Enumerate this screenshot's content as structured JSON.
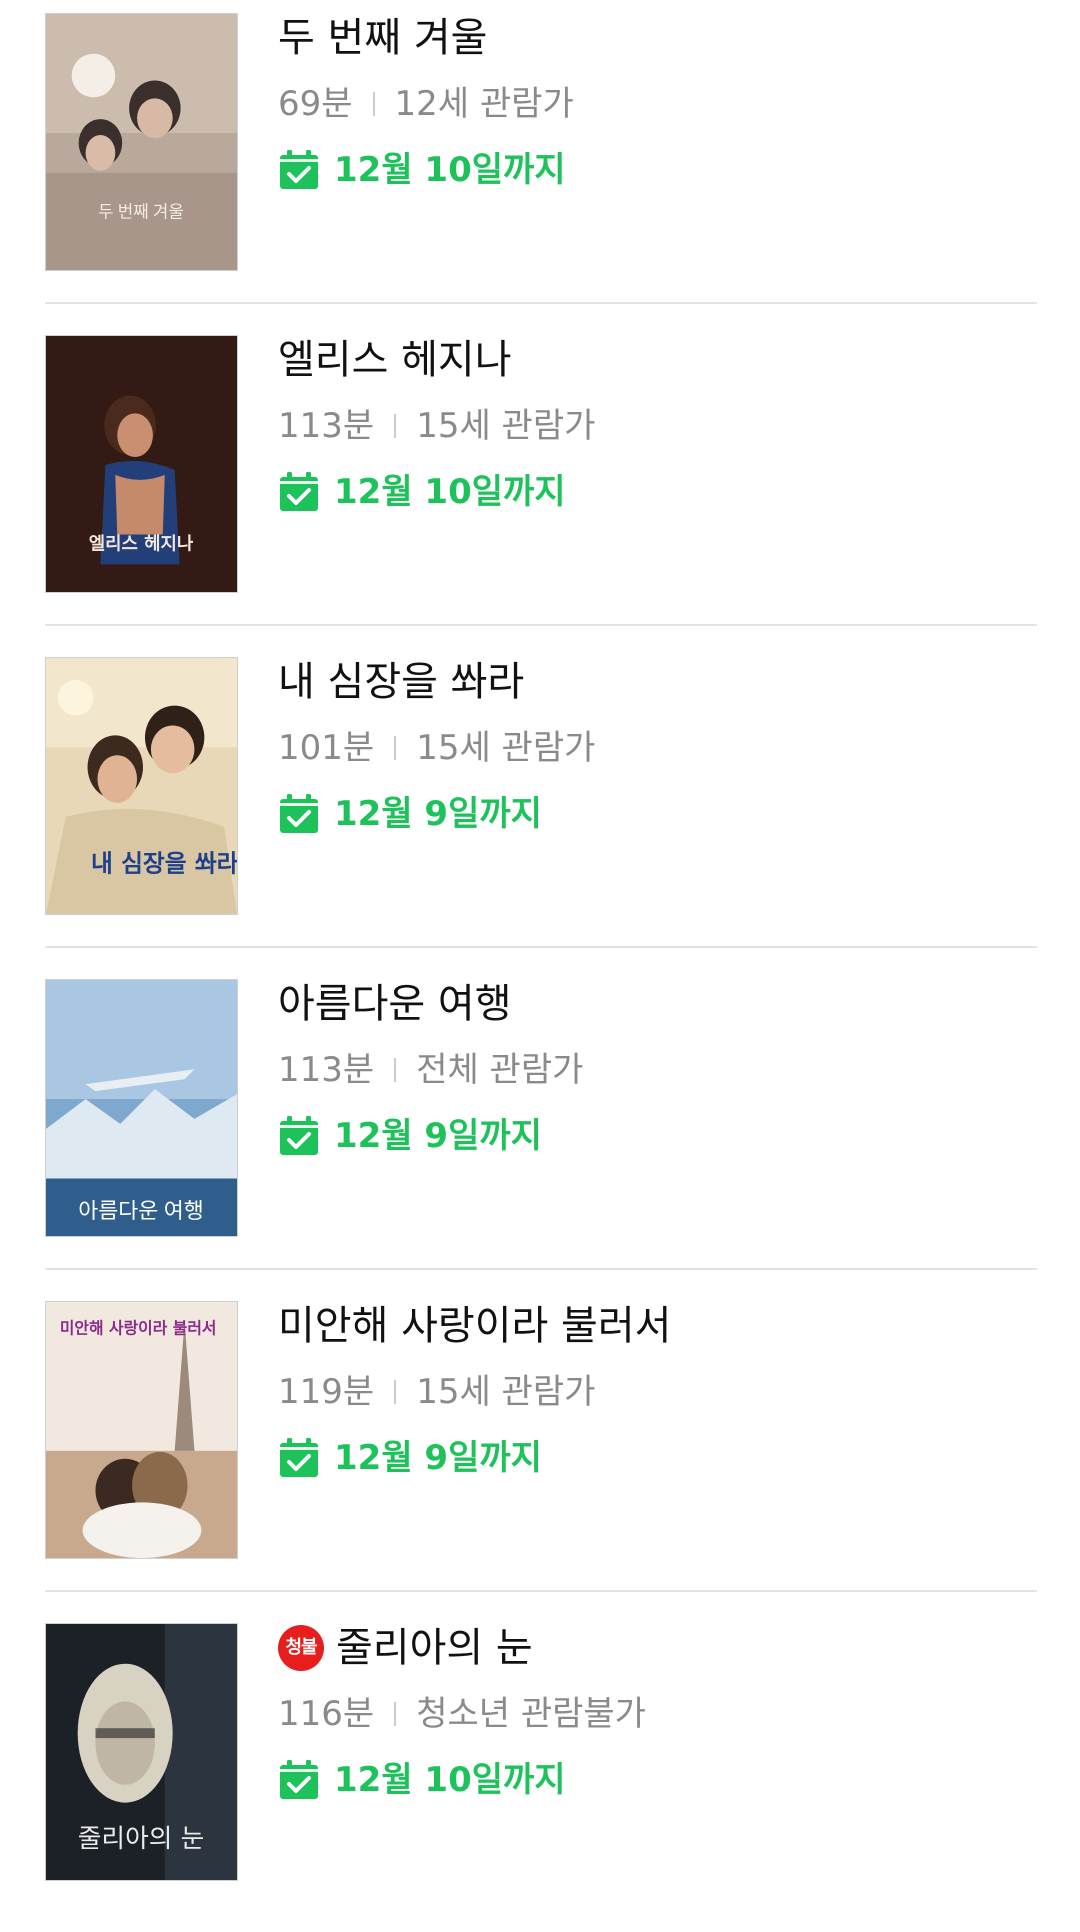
{
  "colors": {
    "accent_green": "#1ec25a",
    "meta_gray": "#8a8a8a",
    "badge_red": "#e61e1e",
    "divider": "#e4e4e4"
  },
  "icons": {
    "availability": "calendar-check-icon"
  },
  "movies": [
    {
      "title": "두 번째 겨울",
      "runtime": "69분",
      "rating": "12세 관람가",
      "available_until": "12월 10일까지",
      "poster_text": "두 번째 겨울"
    },
    {
      "title": "엘리스 헤지나",
      "runtime": "113분",
      "rating": "15세 관람가",
      "available_until": "12월 10일까지",
      "poster_text": "엘리스 헤지나"
    },
    {
      "title": "내 심장을 쏴라",
      "runtime": "101분",
      "rating": "15세 관람가",
      "available_until": "12월 9일까지",
      "poster_text": "내 심장을 쏴라"
    },
    {
      "title": "아름다운 여행",
      "runtime": "113분",
      "rating": "전체 관람가",
      "available_until": "12월 9일까지",
      "poster_text": "아름다운 여행"
    },
    {
      "title": "미안해 사랑이라 불러서",
      "runtime": "119분",
      "rating": "15세 관람가",
      "available_until": "12월 9일까지",
      "poster_text": "미안해 사랑이라 불러서"
    },
    {
      "title": "줄리아의 눈",
      "runtime": "116분",
      "rating": "청소년 관람불가",
      "available_until": "12월 10일까지",
      "badge": "청불",
      "poster_text": "줄리아의 눈"
    }
  ]
}
